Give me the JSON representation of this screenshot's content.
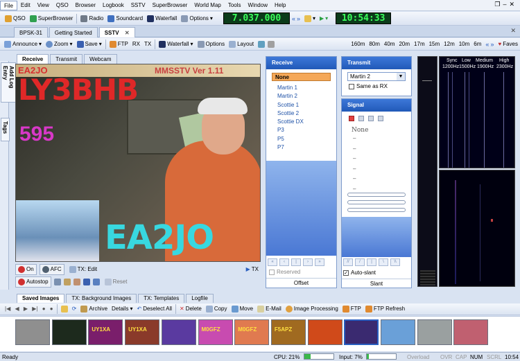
{
  "menu": [
    "File",
    "Edit",
    "View",
    "QSO",
    "Browser",
    "Logbook",
    "SSTV",
    "SuperBrowser",
    "World Map",
    "Tools",
    "Window",
    "Help"
  ],
  "toolbar1": {
    "qso": "QSO",
    "superbrowser": "SuperBrowser",
    "radio": "Radio",
    "soundcard": "Soundcard",
    "waterfall": "Waterfall",
    "options": "Options",
    "frequency": "7.037.000",
    "time": "10:54:33"
  },
  "doctabs": [
    "BPSK-31",
    "Getting Started",
    "SSTV"
  ],
  "toolbar2": {
    "announce": "Announce",
    "zoom": "Zoom",
    "save": "Save",
    "ftp": "FTP",
    "rx": "RX",
    "tx": "TX",
    "waterfall": "Waterfall",
    "options": "Options",
    "layout": "Layout",
    "faves": "Faves",
    "bands": [
      "160m",
      "80m",
      "40m",
      "20m",
      "17m",
      "15m",
      "12m",
      "10m",
      "6m"
    ]
  },
  "sidetabs": [
    "Add Log Entry",
    "Tags"
  ],
  "subtabs": [
    "Receive",
    "Transmit",
    "Webcam"
  ],
  "image": {
    "callsign_top": "EA2JO",
    "version": "MMSSTV Ver 1.11",
    "big_call": "LY3BHB",
    "number": "595",
    "bottom_call": "EA2JO"
  },
  "controls": {
    "on": "On",
    "afc": "AFC",
    "tx_edit": "TX: Edit",
    "tx": "TX",
    "autostop": "Autostop",
    "reset": "Reset"
  },
  "receive": {
    "title": "Receive",
    "selected": "None",
    "modes": [
      "Martin 1",
      "Martin 2",
      "Scottie 1",
      "Scottie 2",
      "Scottie DX",
      "P3",
      "P5",
      "P7"
    ],
    "reserved": "Reserved",
    "offset": "Offset"
  },
  "transmit": {
    "title": "Transmit",
    "mode": "Martin 2",
    "same_as_rx": "Same as RX"
  },
  "signal": {
    "title": "Signal",
    "none": "None",
    "dashes": [
      "–",
      "–",
      "–",
      "–",
      "–",
      "–"
    ],
    "autoslant": "Auto-slant",
    "slant": "Slant"
  },
  "spectrum": {
    "sync": "Sync",
    "sync_hz": "1200Hz",
    "low": "Low",
    "low_hz": "1500Hz",
    "medium": "Medium",
    "medium_hz": "1900Hz",
    "high": "High",
    "high_hz": "2300Hz"
  },
  "bottomtabs": [
    "Saved Images",
    "TX: Background Images",
    "TX: Templates",
    "Logfile"
  ],
  "bottomtools": {
    "archive": "Archive",
    "details": "Details",
    "deselect_all": "Deselect All",
    "delete": "Delete",
    "copy": "Copy",
    "move": "Move",
    "email": "E-Mail",
    "image_processing": "Image Processing",
    "ftp": "FTP",
    "ftp_refresh": "FTP Refresh"
  },
  "thumbs": [
    {
      "text": "",
      "bg": "#8f8f8f"
    },
    {
      "text": "",
      "bg": "#1d2a1d"
    },
    {
      "text": "UY1XA",
      "bg": "#7a1e6b"
    },
    {
      "text": "UY1XA",
      "bg": "#8a3a2a"
    },
    {
      "text": "",
      "bg": "#5a3aa0"
    },
    {
      "text": "M0GFZ",
      "bg": "#c84bb0"
    },
    {
      "text": "M0GFZ",
      "bg": "#e07a50"
    },
    {
      "text": "F5APZ",
      "bg": "#a06a20"
    },
    {
      "text": "",
      "bg": "#d04a1a"
    },
    {
      "text": "",
      "bg": "#3a2a70"
    },
    {
      "text": "",
      "bg": "#6aa0d8"
    },
    {
      "text": "",
      "bg": "#9aa0a0"
    },
    {
      "text": "",
      "bg": "#c06070"
    }
  ],
  "status": {
    "ready": "Ready",
    "cpu": "CPU: 21%",
    "cpu_level": 0.21,
    "input": "Input: 7%",
    "input_level": 0.07,
    "overload": "Overload",
    "ovr": "OVR",
    "cap": "CAP",
    "num": "NUM",
    "scrl": "SCRL",
    "time": "10:54"
  }
}
